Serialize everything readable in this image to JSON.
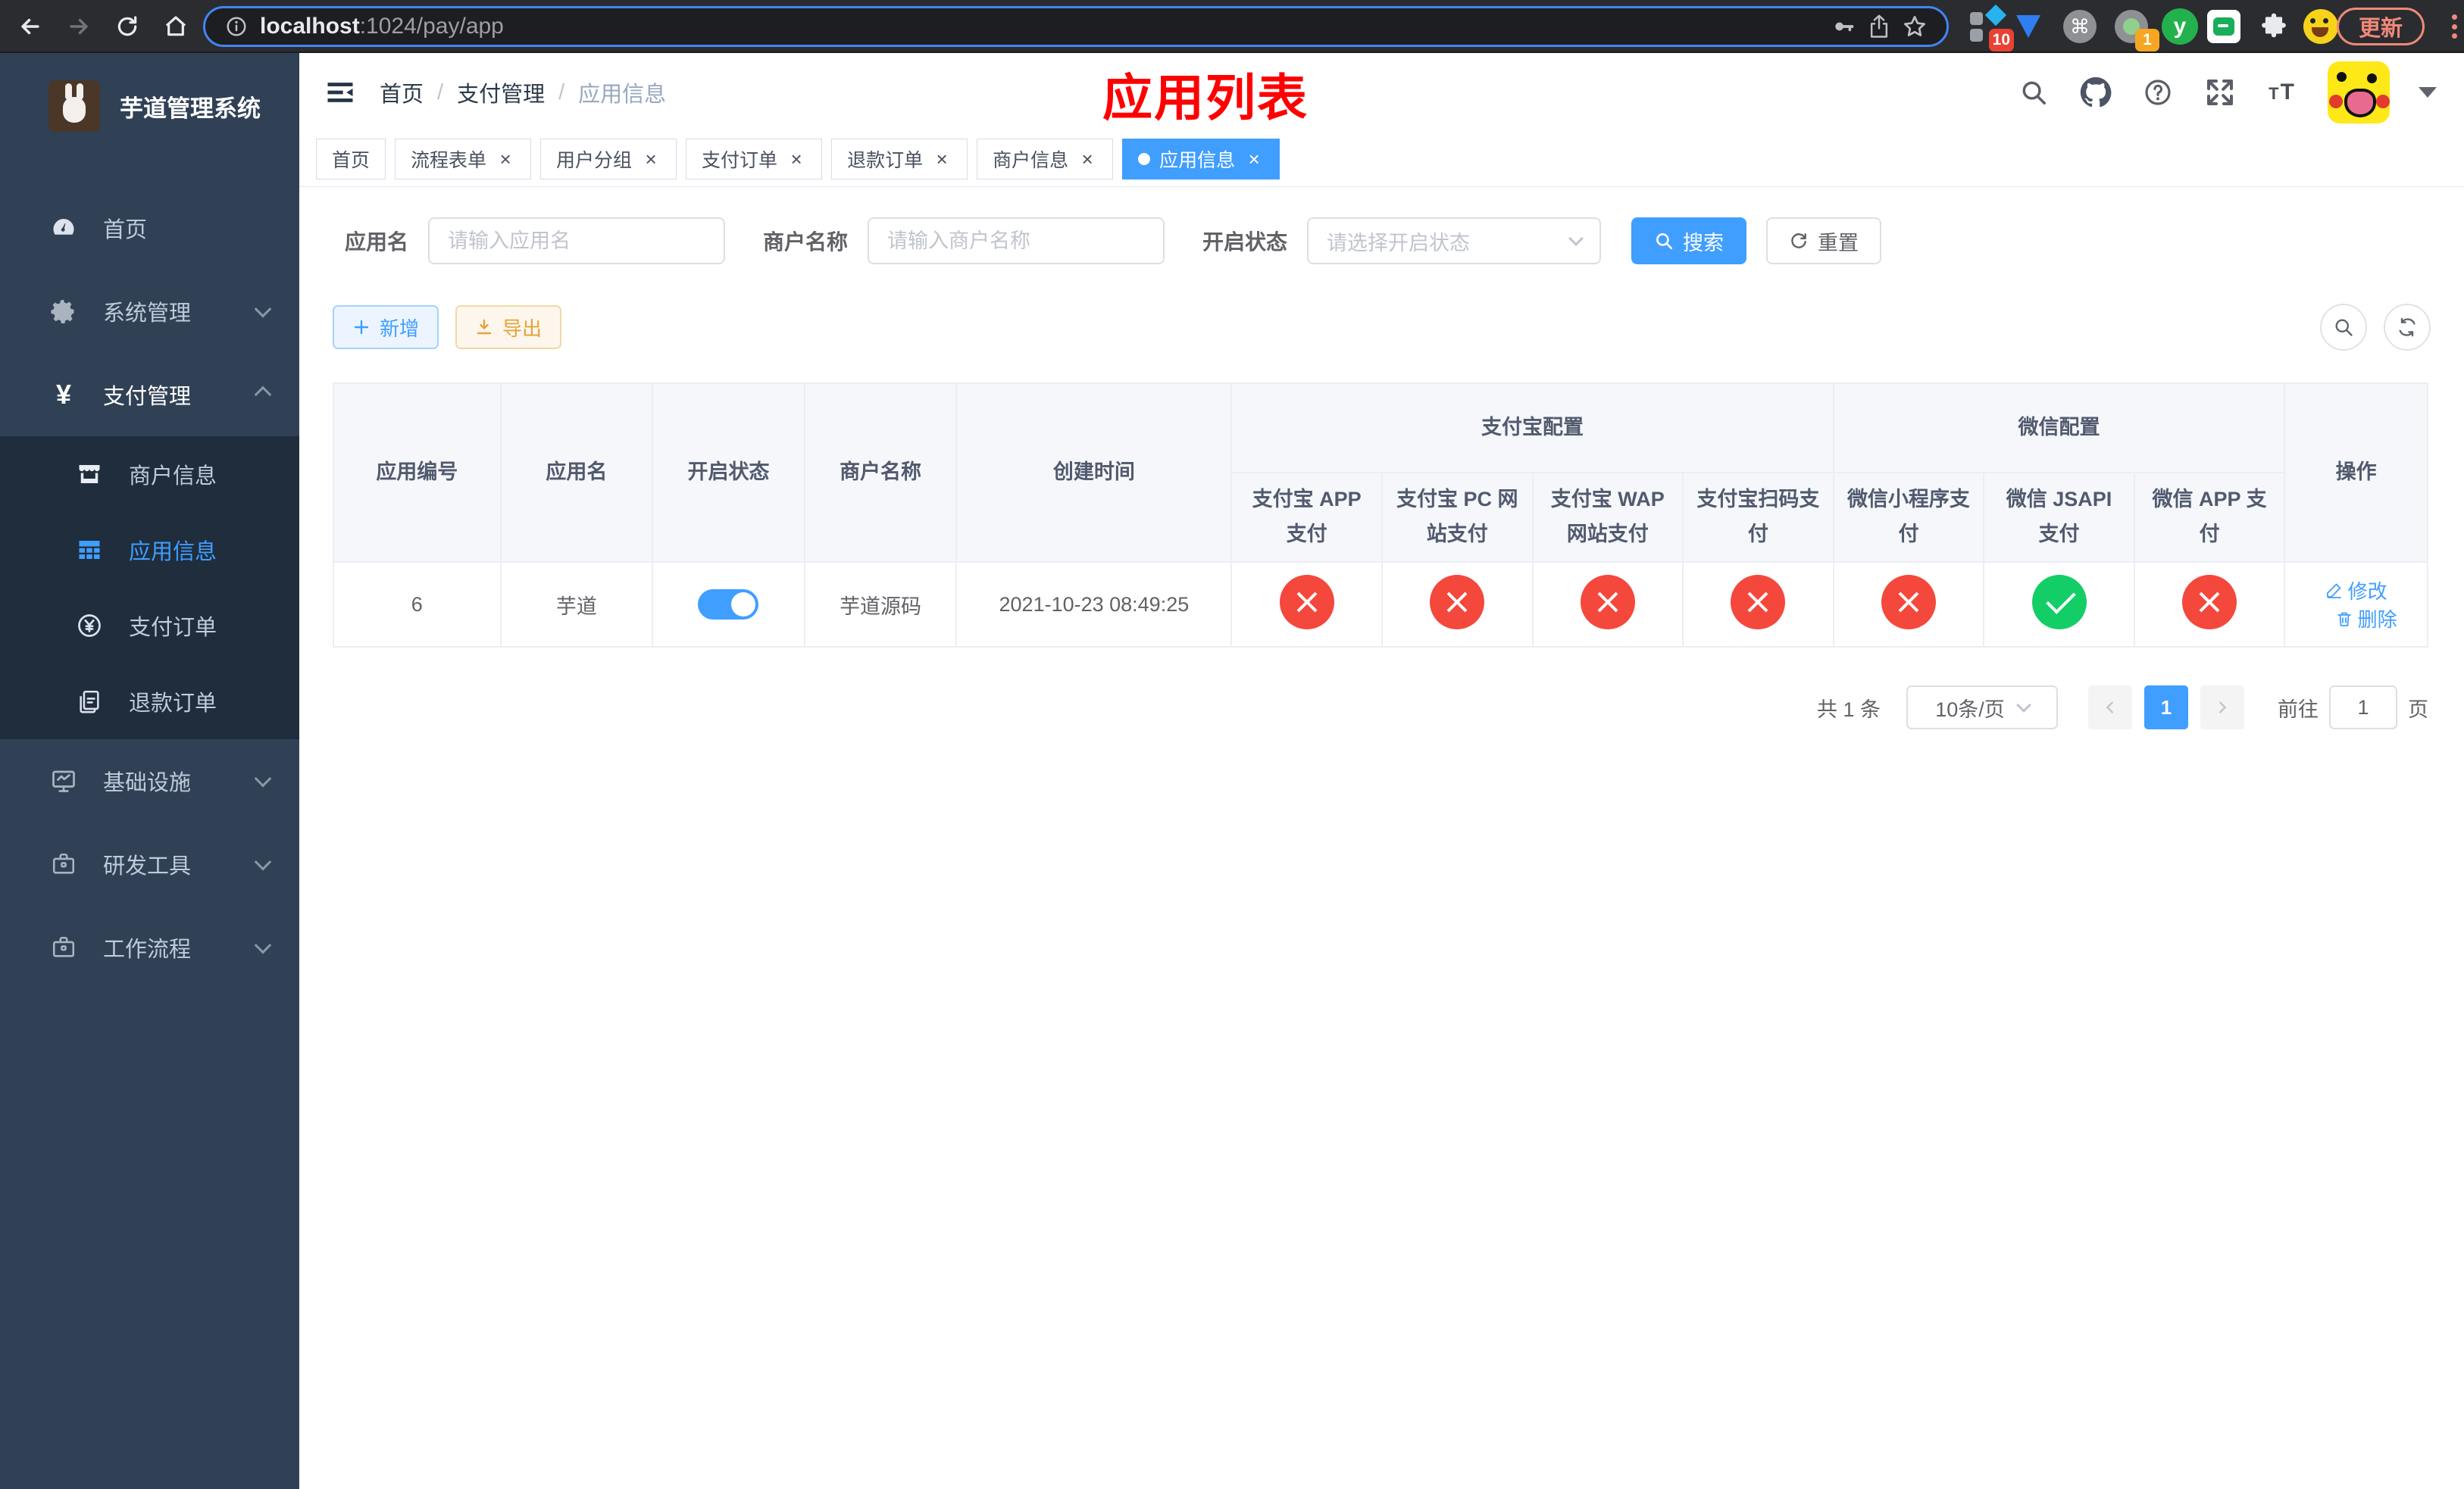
{
  "colors": {
    "primary": "#409eff",
    "success": "#13ce66",
    "danger": "#f4483c",
    "warning": "#e6a23c",
    "sidebar_bg": "#304156",
    "submenu_bg": "#1f2d3d",
    "annotation_red": "#ff0000",
    "active_tab": "#409eff"
  },
  "browser": {
    "url_host": "localhost",
    "url_rest": ":1024/pay/app",
    "ext_badge_blue_diamond": "10",
    "ext_badge_green_dot": "1",
    "ext_y_letter": "y",
    "update_label": "更新"
  },
  "sidebar": {
    "title": "芋道管理系统",
    "menu": [
      {
        "label": "首页"
      },
      {
        "label": "系统管理"
      },
      {
        "label": "支付管理"
      },
      {
        "label": "商户信息"
      },
      {
        "label": "应用信息"
      },
      {
        "label": "支付订单"
      },
      {
        "label": "退款订单"
      },
      {
        "label": "基础设施"
      },
      {
        "label": "研发工具"
      },
      {
        "label": "工作流程"
      }
    ]
  },
  "header": {
    "breadcrumb": [
      "首页",
      "支付管理",
      "应用信息"
    ],
    "annotation": "应用列表"
  },
  "tabs": [
    {
      "label": "首页"
    },
    {
      "label": "流程表单"
    },
    {
      "label": "用户分组"
    },
    {
      "label": "支付订单"
    },
    {
      "label": "退款订单"
    },
    {
      "label": "商户信息"
    },
    {
      "label": "应用信息",
      "active": true
    }
  ],
  "filters": {
    "app_name_label": "应用名",
    "app_name_placeholder": "请输入应用名",
    "merchant_label": "商户名称",
    "merchant_placeholder": "请输入商户名称",
    "status_label": "开启状态",
    "status_placeholder": "请选择开启状态",
    "search_label": "搜索",
    "reset_label": "重置"
  },
  "toolbar": {
    "add_label": "新增",
    "export_label": "导出"
  },
  "table": {
    "col_app_id": "应用编号",
    "col_app_name": "应用名",
    "col_status": "开启状态",
    "col_merchant": "商户名称",
    "col_created": "创建时间",
    "group_alipay": "支付宝配置",
    "group_wechat": "微信配置",
    "col_alipay_app": "支付宝 APP 支付",
    "col_alipay_pc": "支付宝 PC 网站支付",
    "col_alipay_wap": "支付宝 WAP 网站支付",
    "col_alipay_qr": "支付宝扫码支付",
    "col_wx_mini": "微信小程序支付",
    "col_wx_jsapi": "微信 JSAPI 支付",
    "col_wx_app": "微信 APP 支付",
    "col_action": "操作",
    "rows": [
      {
        "id": "6",
        "name": "芋道",
        "enabled": true,
        "merchant": "芋道源码",
        "created": "2021-10-23 08:49:25",
        "configs": [
          "err",
          "err",
          "err",
          "err",
          "err",
          "ok",
          "err"
        ],
        "edit_label": "修改",
        "delete_label": "删除"
      }
    ]
  },
  "pagination": {
    "total": "共 1 条",
    "page_size": "10条/页",
    "page": "1",
    "goto_label": "前往",
    "goto_value": "1",
    "unit_label": "页"
  }
}
